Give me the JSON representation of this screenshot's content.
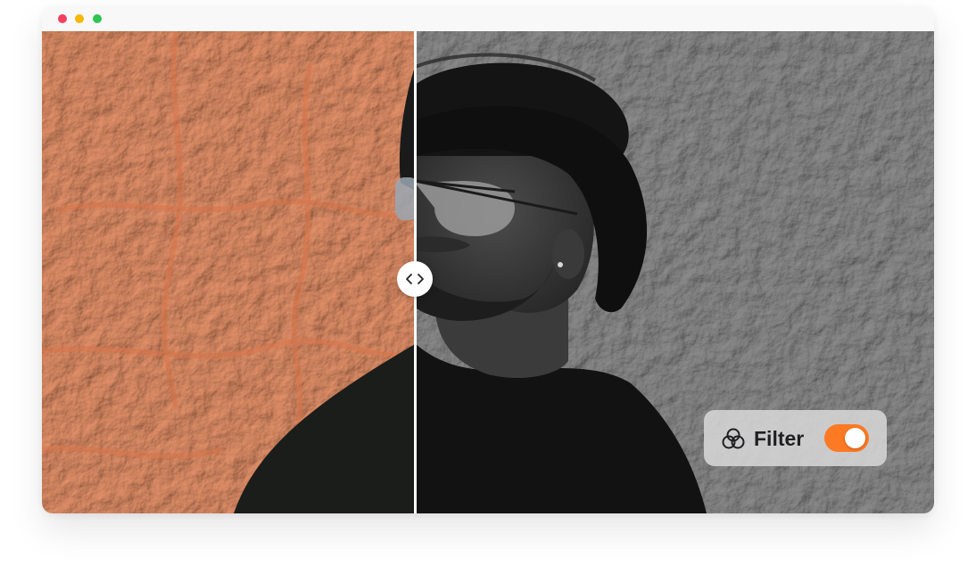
{
  "window": {
    "controls": {
      "close_color": "#f23f5f",
      "minimize_color": "#f5b800",
      "maximize_color": "#2fc552"
    }
  },
  "comparison": {
    "handle_icon": "chevron-left-right-icon",
    "split_position": 0.42,
    "left_view": "color",
    "right_view": "grayscale"
  },
  "filter_control": {
    "icon": "overlapping-circles-icon",
    "label": "Filter",
    "enabled": true,
    "accent_color": "#fd7a24"
  }
}
